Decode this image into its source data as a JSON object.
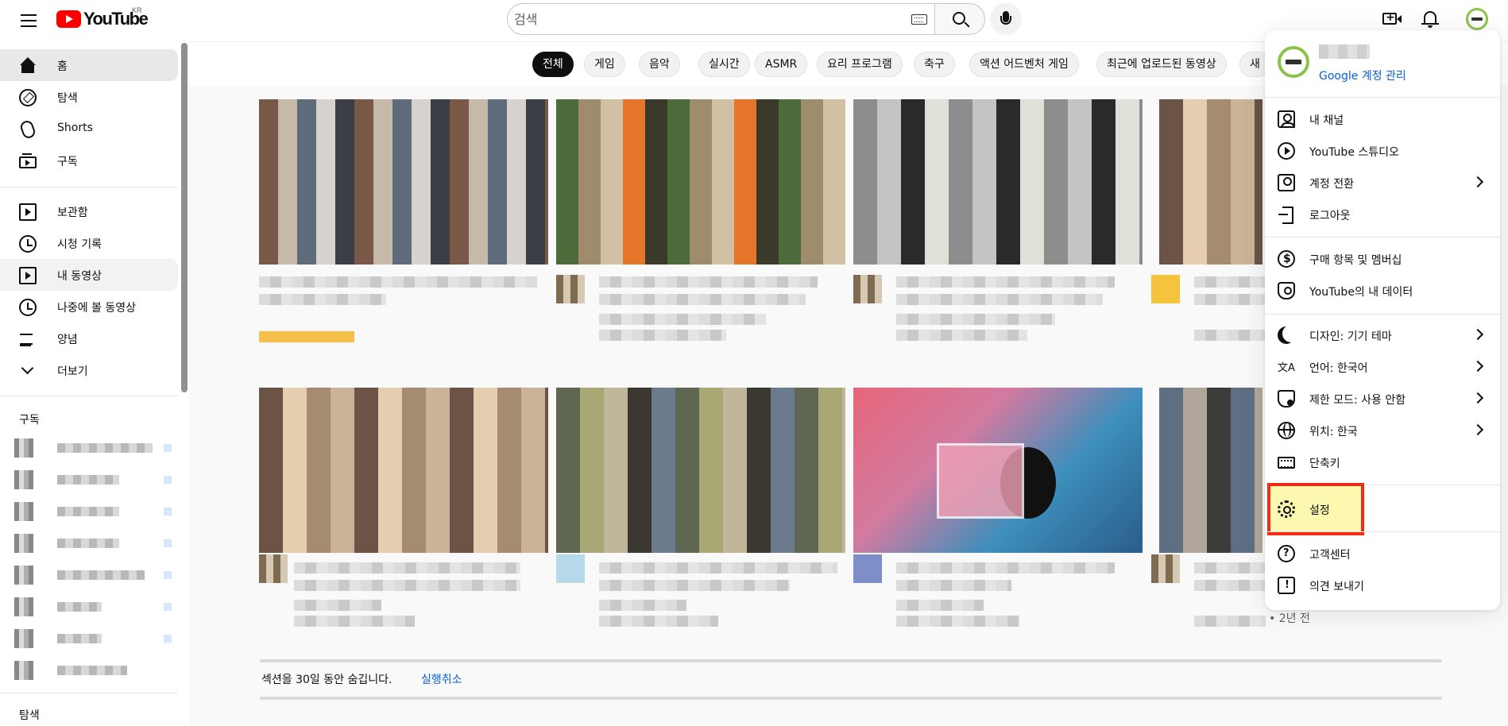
{
  "header": {
    "logo_text": "YouTube",
    "country_code": "KR",
    "search_placeholder": "검색"
  },
  "sidebar": {
    "main_items": [
      {
        "label": "홈",
        "icon": "home-icon"
      },
      {
        "label": "탐색",
        "icon": "explore-icon"
      },
      {
        "label": "Shorts",
        "icon": "shorts-icon"
      },
      {
        "label": "구독",
        "icon": "subscriptions-icon"
      }
    ],
    "library_items": [
      {
        "label": "보관함",
        "icon": "library-icon"
      },
      {
        "label": "시청 기록",
        "icon": "history-icon"
      },
      {
        "label": "내 동영상",
        "icon": "your-videos-icon"
      },
      {
        "label": "나중에 볼 동영상",
        "icon": "watch-later-icon"
      },
      {
        "label": "양념",
        "icon": "playlist-icon"
      },
      {
        "label": "더보기",
        "icon": "chevron-down-icon"
      }
    ],
    "subscriptions_heading": "구독",
    "explore_heading": "탐색"
  },
  "chips": [
    "전체",
    "게임",
    "음악",
    "실시간",
    "ASMR",
    "요리 프로그램",
    "축구",
    "액션 어드벤처 게임",
    "최근에 업로드된 동영상",
    "새"
  ],
  "content": {
    "hidden_section_text": "섹션을 30일 동안 숨깁니다.",
    "undo_label": "실행취소",
    "partial_time_text": "• 2년 전"
  },
  "account_menu": {
    "manage_account_label": "Google 계정 관리",
    "group1": [
      {
        "label": "내 채널",
        "icon": "channel-icon",
        "arrow": false
      },
      {
        "label": "YouTube 스튜디오",
        "icon": "studio-icon",
        "arrow": false
      },
      {
        "label": "계정 전환",
        "icon": "switch-account-icon",
        "arrow": true
      },
      {
        "label": "로그아웃",
        "icon": "sign-out-icon",
        "arrow": false
      }
    ],
    "group2": [
      {
        "label": "구매 항목 및 멤버십",
        "icon": "purchases-icon",
        "arrow": false
      },
      {
        "label": "YouTube의 내 데이터",
        "icon": "your-data-icon",
        "arrow": false
      }
    ],
    "group3": [
      {
        "label": "디자인: 기기 테마",
        "icon": "appearance-icon",
        "arrow": true
      },
      {
        "label": "언어: 한국어",
        "icon": "language-icon",
        "arrow": true
      },
      {
        "label": "제한 모드: 사용 안함",
        "icon": "restricted-mode-icon",
        "arrow": true
      },
      {
        "label": "위치: 한국",
        "icon": "location-icon",
        "arrow": true
      },
      {
        "label": "단축키",
        "icon": "keyboard-shortcuts-icon",
        "arrow": false
      }
    ],
    "settings_label": "설정",
    "group5": [
      {
        "label": "고객센터",
        "icon": "help-icon",
        "arrow": false
      },
      {
        "label": "의견 보내기",
        "icon": "feedback-icon",
        "arrow": false
      }
    ]
  },
  "colors": {
    "brand_red": "#ff0000",
    "link_blue": "#065fd4",
    "highlight_border": "#f22c16",
    "highlight_fill": "#fcf8b0"
  }
}
